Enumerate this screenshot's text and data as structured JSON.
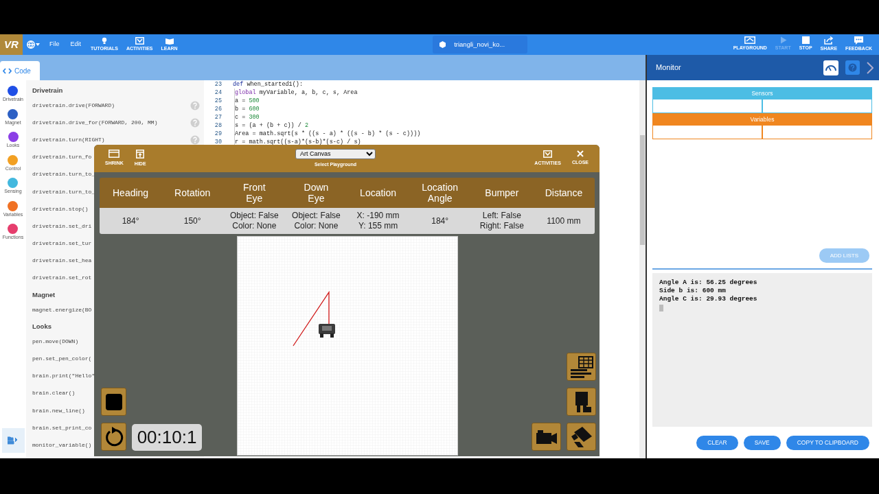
{
  "top_bar": {
    "logo": "VR",
    "menus": [
      "File",
      "Edit"
    ],
    "tools": [
      "TUTORIALS",
      "ACTIVITIES",
      "LEARN"
    ],
    "project_name": "triangli_novi_ko...",
    "actions": [
      {
        "label": "PLAYGROUND",
        "disabled": false
      },
      {
        "label": "START",
        "disabled": true
      },
      {
        "label": "STOP",
        "disabled": false
      },
      {
        "label": "SHARE",
        "disabled": false
      },
      {
        "label": "FEEDBACK",
        "disabled": false
      }
    ]
  },
  "editor_tab": {
    "label": "Code",
    "selected": true
  },
  "categories": [
    {
      "label": "Drivetrain",
      "color": "#1f4fe6"
    },
    {
      "label": "Magnet",
      "color": "#2d60c4"
    },
    {
      "label": "Looks",
      "color": "#8b3fe6"
    },
    {
      "label": "Control",
      "color": "#f2a023"
    },
    {
      "label": "Sensing",
      "color": "#43b8de"
    },
    {
      "label": "Variables",
      "color": "#f07124"
    },
    {
      "label": "Functions",
      "color": "#e63e6d"
    }
  ],
  "palette": [
    {
      "heading": "Drivetrain",
      "items": [
        {
          "text": "drivetrain.drive(FORWARD)",
          "help": true
        },
        {
          "text": "drivetrain.drive_for(FORWARD, 200, MM)",
          "help": true
        },
        {
          "text": "drivetrain.turn(RIGHT)",
          "help": true
        },
        {
          "text": "drivetrain.turn_fo"
        },
        {
          "text": "drivetrain.turn_to_"
        },
        {
          "text": "drivetrain.turn_to_"
        },
        {
          "text": "drivetrain.stop()"
        },
        {
          "text": "drivetrain.set_dri"
        },
        {
          "text": "drivetrain.set_tur"
        },
        {
          "text": "drivetrain.set_hea"
        },
        {
          "text": "drivetrain.set_rot"
        }
      ]
    },
    {
      "heading": "Magnet",
      "items": [
        {
          "text": "magnet.energize(BO"
        }
      ]
    },
    {
      "heading": "Looks",
      "items": [
        {
          "text": "pen.move(DOWN)"
        },
        {
          "text": "pen.set_pen_color("
        },
        {
          "text": "brain.print(\"Hello\""
        },
        {
          "text": "brain.clear()"
        },
        {
          "text": "brain.new_line()"
        },
        {
          "text": "brain.set_print_co"
        },
        {
          "text": "monitor_variable()"
        }
      ]
    }
  ],
  "code": {
    "lines": [
      {
        "number": "23",
        "segments": [
          {
            "text": "def",
            "kind": "keyword"
          },
          {
            "text": " when_started1():",
            "kind": "plain"
          }
        ],
        "children": [
          {
            "number": "24",
            "segments": [
              {
                "text": "global",
                "kind": "builtin"
              },
              {
                "text": " myVariable, a, b, c, s, Area",
                "kind": "plain"
              }
            ]
          },
          {
            "number": "25",
            "segments": [
              {
                "text": "a = ",
                "kind": "plain"
              },
              {
                "text": "500",
                "kind": "number"
              }
            ]
          },
          {
            "number": "26",
            "segments": [
              {
                "text": "b = ",
                "kind": "plain"
              },
              {
                "text": "600",
                "kind": "number"
              }
            ]
          },
          {
            "number": "27",
            "segments": [
              {
                "text": "c = ",
                "kind": "plain"
              },
              {
                "text": "300",
                "kind": "number"
              }
            ]
          },
          {
            "number": "28",
            "segments": [
              {
                "text": "s = (a + (b + c)) / ",
                "kind": "plain"
              },
              {
                "text": "2",
                "kind": "number"
              }
            ]
          },
          {
            "number": "29",
            "segments": [
              {
                "text": "Area = math.sqrt(s * ((s - a) * ((s - b) * (s - c))))",
                "kind": "plain"
              }
            ]
          },
          {
            "number": "30",
            "segments": [
              {
                "text": "r = math.sqrt((s-a)*(s-b)*(s-c) / s)",
                "kind": "plain"
              }
            ]
          }
        ]
      }
    ]
  },
  "playground": {
    "left_tools": [
      "SHRINK",
      "HIDE"
    ],
    "select": {
      "value": "Art Canvas",
      "label": "Select Playground"
    },
    "right_tools": [
      "ACTIVITIES",
      "CLOSE"
    ],
    "sensors": [
      {
        "header": "Heading",
        "value": "184°"
      },
      {
        "header": "Rotation",
        "value": "150°"
      },
      {
        "header": "Front\nEye",
        "value": "Object: False\nColor: None"
      },
      {
        "header": "Down\nEye",
        "value": "Object: False\nColor: None"
      },
      {
        "header": "Location",
        "value": "X: -190 mm\nY: 155 mm"
      },
      {
        "header": "Location\nAngle",
        "value": "184°"
      },
      {
        "header": "Bumper",
        "value": "Left: False\nRight: False"
      },
      {
        "header": "Distance",
        "value": "1100 mm"
      }
    ],
    "timer": "00:10:1"
  },
  "monitor": {
    "title": "Monitor",
    "sections": [
      {
        "title": "Sensors",
        "color": "#4cbde4"
      },
      {
        "title": "Variables",
        "color": "#f0861f"
      }
    ],
    "add_lists": {
      "label": "ADD LISTS",
      "disabled": true
    },
    "console": [
      "Angle A is: 56.25 degrees",
      "Side b is: 600 mm",
      "Angle C is: 29.93 degrees"
    ],
    "buttons": [
      "CLEAR",
      "SAVE",
      "COPY TO CLIPBOARD"
    ]
  }
}
